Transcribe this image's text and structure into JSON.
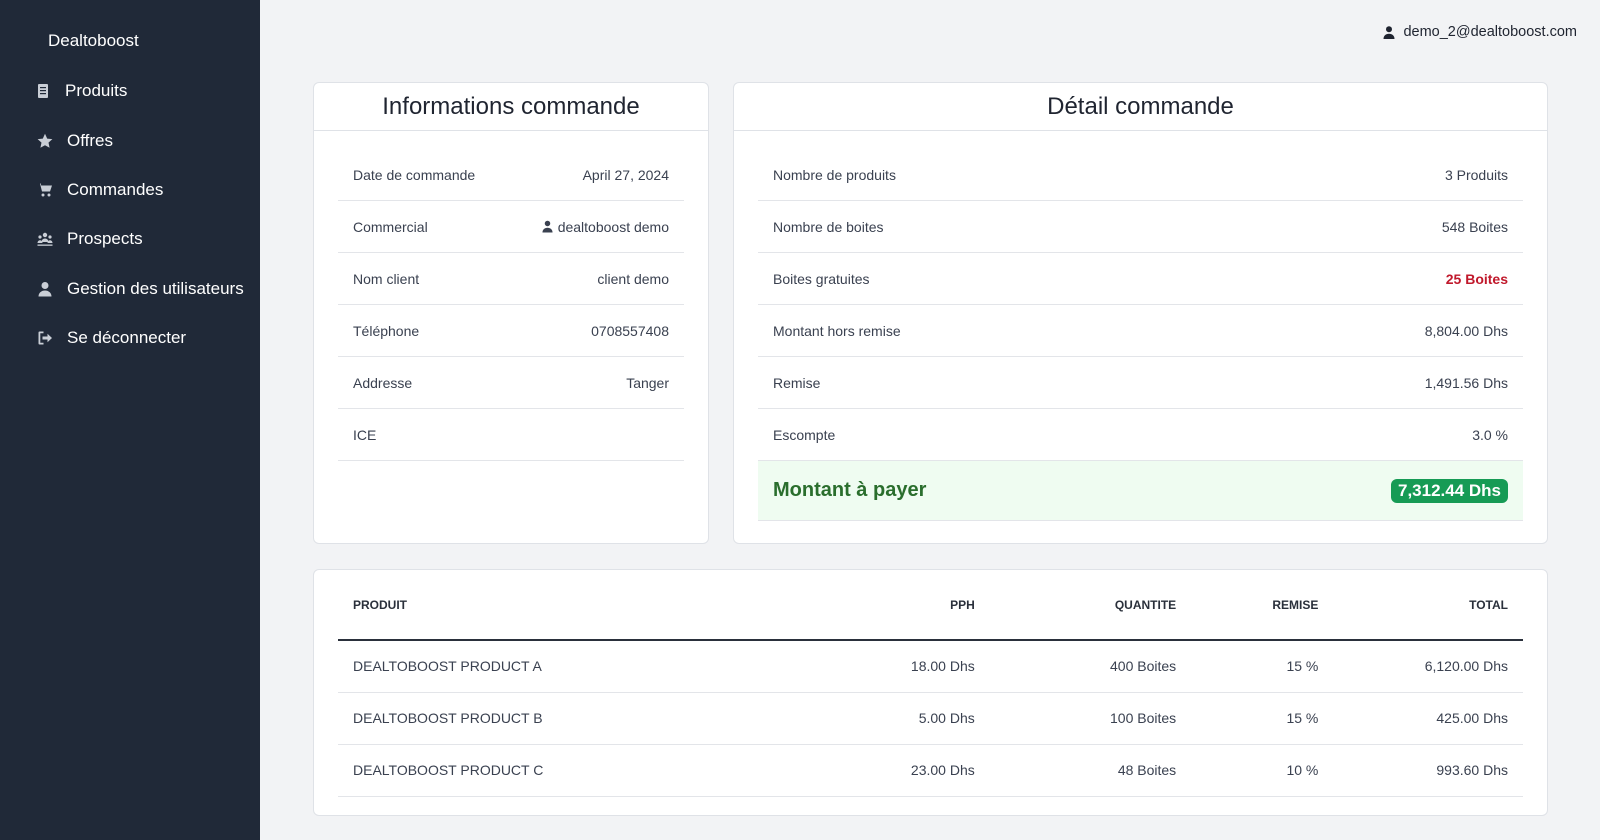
{
  "sidebar": {
    "brand": "Dealtoboost",
    "items": [
      {
        "label": "Produits",
        "icon": "document-icon"
      },
      {
        "label": "Offres",
        "icon": "star-icon"
      },
      {
        "label": "Commandes",
        "icon": "cart-icon"
      },
      {
        "label": "Prospects",
        "icon": "users-icon"
      },
      {
        "label": "Gestion des utilisateurs",
        "icon": "user-icon"
      },
      {
        "label": "Se déconnecter",
        "icon": "logout-icon"
      }
    ]
  },
  "header": {
    "user_email": "demo_2@dealtoboost.com"
  },
  "info": {
    "title": "Informations commande",
    "rows": [
      {
        "label": "Date de commande",
        "value": "April 27, 2024"
      },
      {
        "label": "Commercial",
        "value": "dealtoboost demo"
      },
      {
        "label": "Nom client",
        "value": "client demo"
      },
      {
        "label": "Téléphone",
        "value": "0708557408"
      },
      {
        "label": "Addresse",
        "value": "Tanger"
      },
      {
        "label": "ICE",
        "value": ""
      }
    ]
  },
  "detail": {
    "title": "Détail commande",
    "rows": [
      {
        "label": "Nombre de produits",
        "value": "3 Produits"
      },
      {
        "label": "Nombre de boites",
        "value": "548 Boites"
      },
      {
        "label": "Boites gratuites",
        "value": "25 Boites"
      },
      {
        "label": "Montant hors remise",
        "value": "8,804.00 Dhs"
      },
      {
        "label": "Remise",
        "value": "1,491.56 Dhs"
      },
      {
        "label": "Escompte",
        "value": "3.0 %"
      }
    ],
    "pay_label": "Montant à payer",
    "pay_value": "7,312.44 Dhs"
  },
  "products": {
    "headers": [
      "PRODUIT",
      "PPH",
      "QUANTITE",
      "REMISE",
      "TOTAL"
    ],
    "rows": [
      [
        "DEALTOBOOST PRODUCT A",
        "18.00 Dhs",
        "400 Boites",
        "15 %",
        "6,120.00 Dhs"
      ],
      [
        "DEALTOBOOST PRODUCT B",
        "5.00 Dhs",
        "100 Boites",
        "15 %",
        "425.00 Dhs"
      ],
      [
        "DEALTOBOOST PRODUCT C",
        "23.00 Dhs",
        "48 Boites",
        "10 %",
        "993.60 Dhs"
      ]
    ]
  },
  "colors": {
    "sidebar_bg": "#202938",
    "page_bg": "#f2f3f5",
    "free_boxes": "#c0182b",
    "pay_bg": "#effcf1",
    "pay_badge": "#169b55"
  }
}
